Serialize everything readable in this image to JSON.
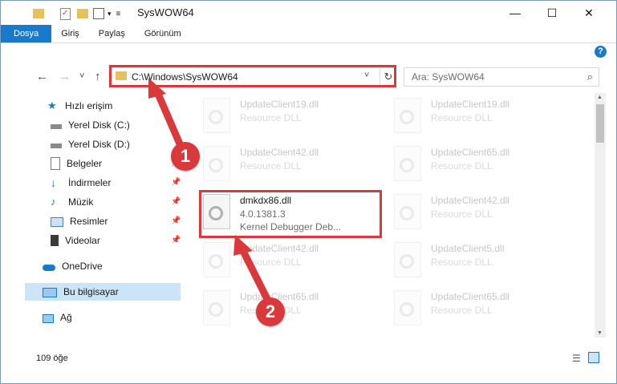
{
  "window": {
    "title": "SysWOW64",
    "minimize": "—",
    "maximize": "☐",
    "close": "✕"
  },
  "ribbon": {
    "tabs": [
      {
        "label": "Dosya"
      },
      {
        "label": "Giriş"
      },
      {
        "label": "Paylaş"
      },
      {
        "label": "Görünüm"
      }
    ],
    "help": "?"
  },
  "navbar": {
    "back": "←",
    "forward": "→",
    "recent": "˅",
    "up": "↑",
    "address": "C:\\Windows\\SysWOW64",
    "search_placeholder": "Ara: SysWOW64"
  },
  "sidebar": {
    "items": [
      {
        "label": "Hızlı erişim",
        "icon": "star-icon"
      },
      {
        "label": "Yerel Disk (C:)",
        "icon": "drive-icon"
      },
      {
        "label": "Yerel Disk (D:)",
        "icon": "drive-icon"
      },
      {
        "label": "Belgeler",
        "icon": "documents-icon"
      },
      {
        "label": "İndirmeler",
        "icon": "download-icon"
      },
      {
        "label": "Müzik",
        "icon": "music-icon"
      },
      {
        "label": "Resimler",
        "icon": "pictures-icon"
      },
      {
        "label": "Videolar",
        "icon": "videos-icon"
      },
      {
        "label": "OneDrive",
        "icon": "cloud-icon"
      },
      {
        "label": "Bu bilgisayar",
        "icon": "computer-icon"
      },
      {
        "label": "Ağ",
        "icon": "network-icon"
      }
    ]
  },
  "files": {
    "left": [
      {
        "name": "UpdateClient19.dll",
        "desc": "Resource DLL"
      },
      {
        "name": "UpdateClient42.dll",
        "desc": "Resource DLL"
      },
      {
        "name": "dmkdx86.dll",
        "version": "4.0.1381.3",
        "desc": "Kernel Debugger Deb..."
      },
      {
        "name": "UpdateClient42.dll",
        "desc": "Resource DLL"
      },
      {
        "name": "UpdateClient65.dll",
        "desc": "Resource DLL"
      }
    ],
    "right": [
      {
        "name": "UpdateClient19.dll",
        "desc": "Resource DLL"
      },
      {
        "name": "UpdateClient65.dll",
        "desc": "Resource DLL"
      },
      {
        "name": "UpdateClient42.dll",
        "desc": "Resource DLL"
      },
      {
        "name": "UpdateClient5.dll",
        "desc": "Resource DLL"
      },
      {
        "name": "UpdateClient65.dll",
        "desc": "Resource DLL"
      }
    ]
  },
  "status": {
    "count": "109 öğe"
  },
  "annotations": {
    "step1": "1",
    "step2": "2"
  },
  "colors": {
    "accent": "#1979ca",
    "highlight": "#d9393a",
    "selection": "#cce4f7"
  }
}
